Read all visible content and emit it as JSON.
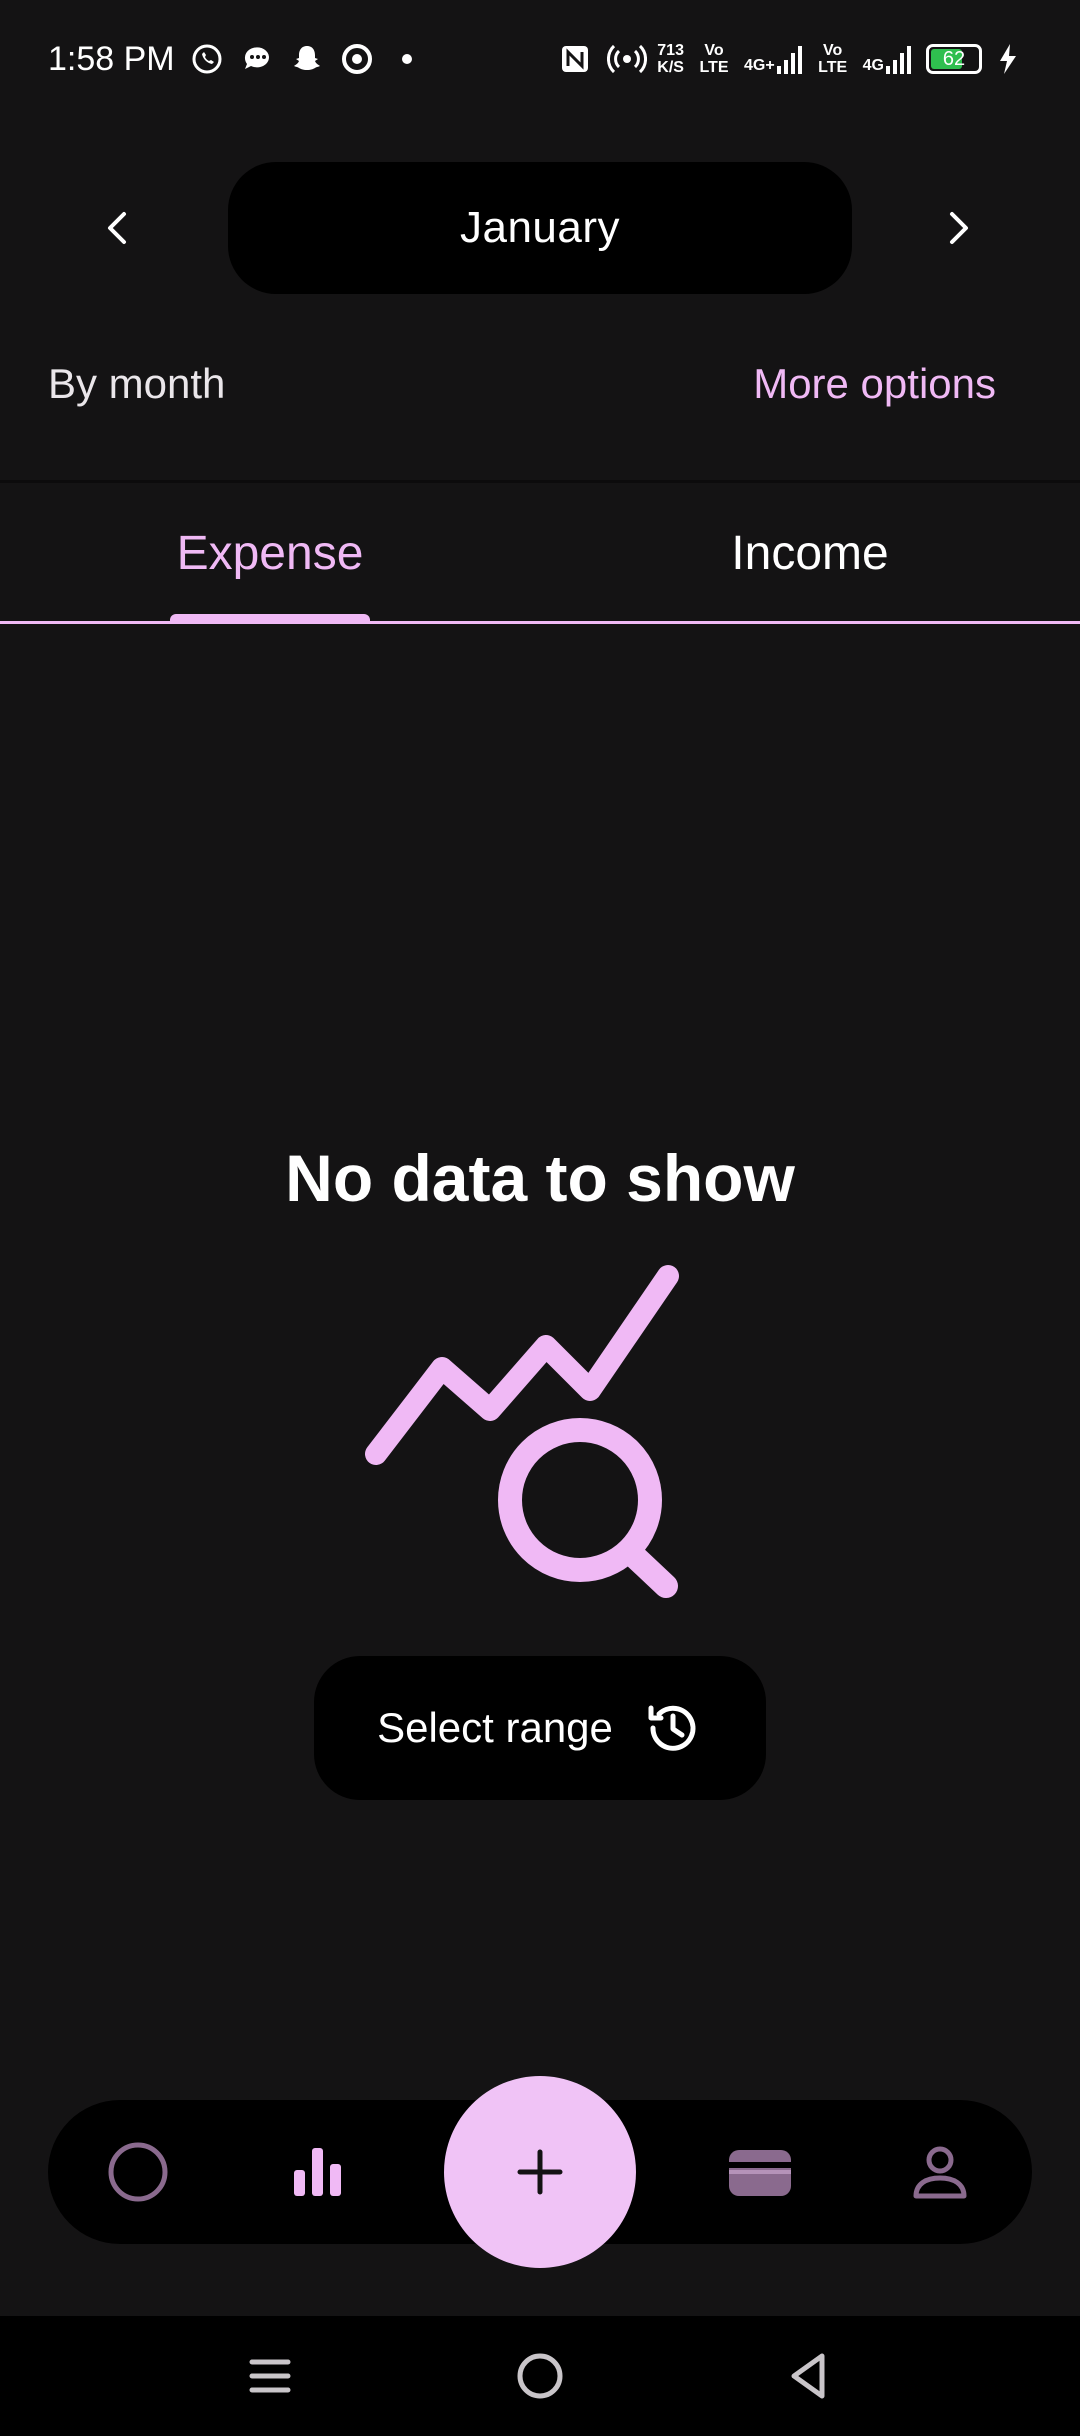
{
  "status_bar": {
    "time": "1:58 PM",
    "speed_value": "713",
    "speed_unit": "K/S",
    "volte_1": "Vo LTE",
    "network_1": "4G+",
    "volte_2": "Vo LTE",
    "network_2": "4G",
    "battery_level": "62"
  },
  "header": {
    "month": "January"
  },
  "filter": {
    "period_label": "By month",
    "more_options_label": "More options"
  },
  "tabs": [
    {
      "label": "Expense",
      "active": true
    },
    {
      "label": "Income",
      "active": false
    }
  ],
  "empty_state": {
    "title": "No data to show",
    "select_range_label": "Select range"
  },
  "bottom_nav": {
    "items": [
      "home-circle-icon",
      "stats-bar-chart-icon",
      "add-icon",
      "wallet-icon",
      "profile-icon"
    ],
    "active": "stats-bar-chart-icon"
  },
  "colors": {
    "accent": "#f0b9f5",
    "background": "#141314",
    "surface": "#000000",
    "fab": "#f0c3f6"
  }
}
